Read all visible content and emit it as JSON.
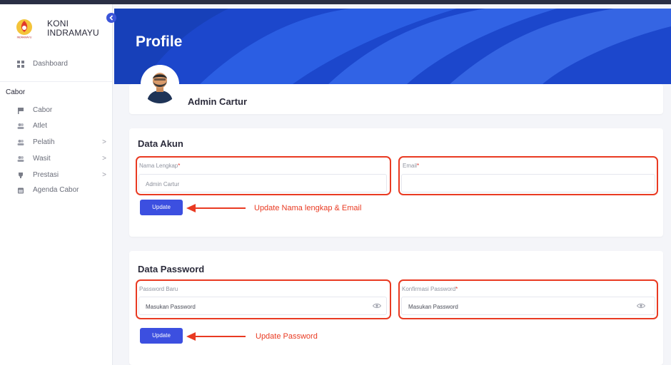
{
  "brand": {
    "line1": "KONI",
    "line2": "INDRAMAYU",
    "logo_text": "INDRAMAYU"
  },
  "sidebar": {
    "dashboard": "Dashboard",
    "section": "Cabor",
    "items": [
      {
        "label": "Cabor",
        "icon": "flag-icon",
        "chevron": ""
      },
      {
        "label": "Atlet",
        "icon": "users-icon",
        "chevron": ""
      },
      {
        "label": "Pelatih",
        "icon": "users-icon",
        "chevron": ">"
      },
      {
        "label": "Wasit",
        "icon": "users-icon",
        "chevron": ">"
      },
      {
        "label": "Prestasi",
        "icon": "trophy-icon",
        "chevron": ">"
      },
      {
        "label": "Agenda Cabor",
        "icon": "calendar-icon",
        "chevron": ""
      }
    ]
  },
  "header": {
    "title": "Profile"
  },
  "profile": {
    "name": "Admin Cartur"
  },
  "akun": {
    "title": "Data Akun",
    "nama_label": "Nama Lengkap",
    "nama_value": "Admin Cartur",
    "email_label": "Email",
    "email_value": "",
    "update": "Update",
    "annotation": "Update Nama lengkap & Email"
  },
  "password": {
    "title": "Data Password",
    "baru_label": "Password Baru",
    "baru_placeholder": "Masukan Password",
    "konfirmasi_label": "Konfirmasi Password",
    "konfirmasi_placeholder": "Masukan Password",
    "update": "Update",
    "annotation": "Update Password"
  },
  "colors": {
    "primary": "#3c4fe0",
    "banner": "#1f4fd6",
    "annotation": "#e93a22"
  }
}
